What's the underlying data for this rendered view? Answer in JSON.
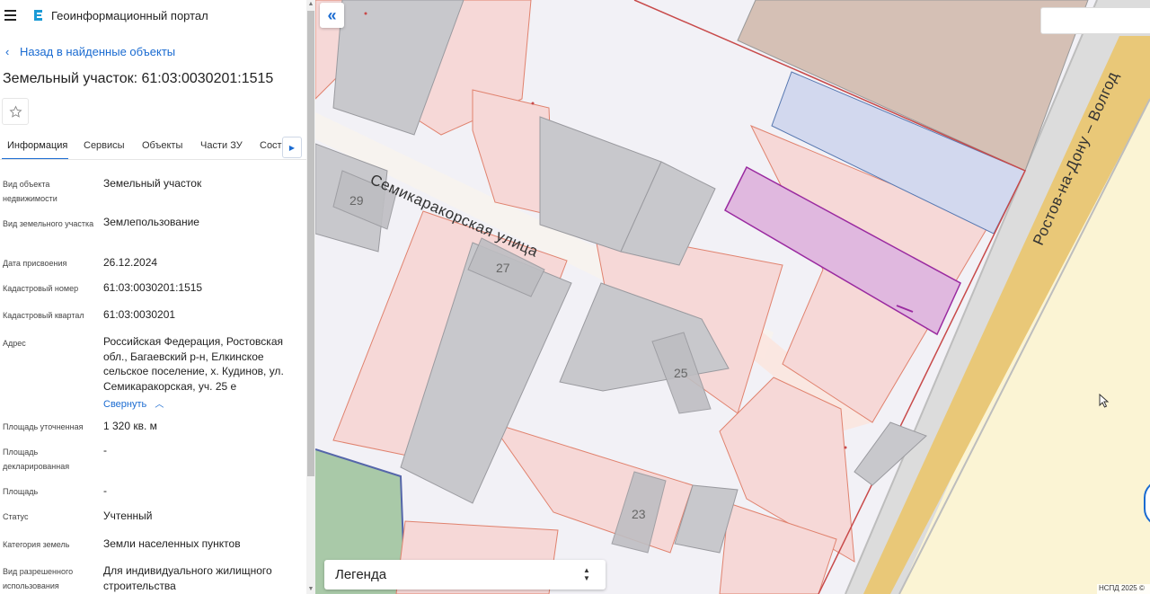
{
  "header": {
    "portal_title": "Геоинформационный портал"
  },
  "sidebar": {
    "back_label": "Назад в найденные объекты",
    "title": "Земельный участок: 61:03:0030201:1515",
    "tabs": [
      {
        "label": "Информация",
        "active": true
      },
      {
        "label": "Сервисы"
      },
      {
        "label": "Объекты"
      },
      {
        "label": "Части ЗУ"
      },
      {
        "label": "Соста"
      }
    ],
    "properties": [
      {
        "label": "Вид объекта недвижимости",
        "value": "Земельный участок"
      },
      {
        "label": "Вид земельного участка",
        "value": "Землепользование"
      },
      {
        "label": "Дата присвоения",
        "value": "26.12.2024"
      },
      {
        "label": "Кадастровый номер",
        "value": "61:03:0030201:1515"
      },
      {
        "label": "Кадастровый квартал",
        "value": "61:03:0030201"
      },
      {
        "label": "Адрес",
        "value": "Российская Федерация, Ростовская обл., Багаевский р-н, Елкинское сельское поселение, х. Кудинов, ул. Семикаракорская, уч. 25 е"
      },
      {
        "label": "Площадь уточненная",
        "value": "1 320 кв. м"
      },
      {
        "label": "Площадь декларированная",
        "value": "-"
      },
      {
        "label": "Площадь",
        "value": "-"
      },
      {
        "label": "Статус",
        "value": "Учтенный"
      },
      {
        "label": "Категория земель",
        "value": "Земли населенных пунктов"
      },
      {
        "label": "Вид разрешенного использования",
        "value": "Для индивидуального жилищного строительства"
      }
    ],
    "collapse_label": "Свернуть"
  },
  "map": {
    "street_label": "Семикаракорская улица",
    "road_label": "Ростов-на-Дону – Волгод",
    "building_numbers": [
      "29",
      "27",
      "25",
      "23"
    ],
    "legend_label": "Легенда",
    "copyright": "НСПД 2025 ©",
    "search_value": "",
    "colors": {
      "selected_parcel": "#c864c8",
      "parcel_border": "#e0826e",
      "building_fill": "#c8c8cc",
      "accent": "#1a6bd1"
    }
  },
  "icons": {
    "menu": "hamburger-icon",
    "logo": "portal-logo-icon",
    "back": "chevron-left-icon",
    "favorite": "star-icon",
    "tabs_scroll": "chevron-right-icon",
    "collapse_toggle": "chevron-up-icon",
    "map_collapse": "double-chevron-left-icon",
    "legend_toggle": "up-down-arrows-icon",
    "cursor": "mouse-cursor-icon"
  }
}
